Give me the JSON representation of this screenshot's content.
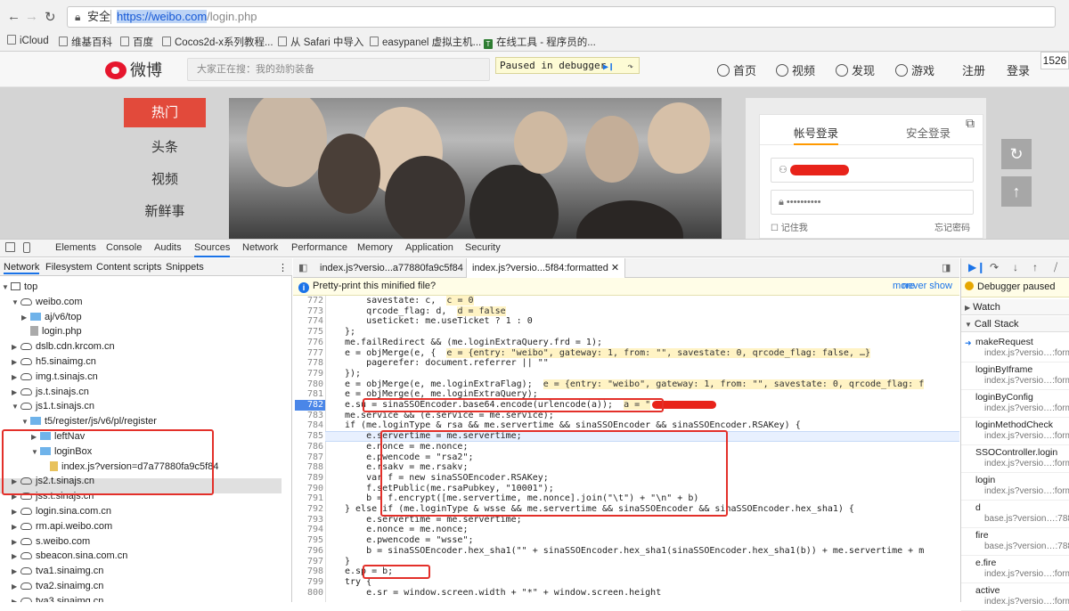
{
  "browser": {
    "security_label": "安全",
    "url_host": "https://weibo.com",
    "url_path": "/login.php",
    "bookmarks": [
      "iCloud",
      "维基百科",
      "百度",
      "Cocos2d-x系列教程...",
      "从 Safari 中导入",
      "easypanel 虚拟主机...",
      "在线工具 - 程序员的..."
    ]
  },
  "weibo": {
    "logo_text": "微博",
    "search_placeholder": "大家正在搜：我的劲豹装备",
    "paused_banner": "Paused in debugger",
    "nav": [
      "首页",
      "视频",
      "发现",
      "游戏",
      "注册",
      "登录"
    ],
    "corner_tip": "1526",
    "side_hot": "热门",
    "side_items": [
      "头条",
      "视频",
      "新鲜事"
    ],
    "login_tabs": [
      "帐号登录",
      "安全登录"
    ],
    "password_mask": "••••••••••",
    "remember": "记住我",
    "forgot": "忘记密码"
  },
  "devtools": {
    "tabs": [
      "Elements",
      "Console",
      "Audits",
      "Sources",
      "Network",
      "Performance",
      "Memory",
      "Application",
      "Security"
    ],
    "active_tab": "Sources",
    "nav_tabs": [
      "Network",
      "Filesystem",
      "Content scripts",
      "Snippets"
    ],
    "tree": [
      {
        "label": "top",
        "icon": "frame",
        "level": 0,
        "arrow": "▼"
      },
      {
        "label": "weibo.com",
        "icon": "cloud",
        "level": 1,
        "arrow": "▼"
      },
      {
        "label": "aj/v6/top",
        "icon": "folder",
        "level": 2,
        "arrow": "▶"
      },
      {
        "label": "login.php",
        "icon": "file",
        "level": 2,
        "arrow": ""
      },
      {
        "label": "dslb.cdn.krcom.cn",
        "icon": "cloud",
        "level": 1,
        "arrow": "▶"
      },
      {
        "label": "h5.sinaimg.cn",
        "icon": "cloud",
        "level": 1,
        "arrow": "▶"
      },
      {
        "label": "img.t.sinajs.cn",
        "icon": "cloud",
        "level": 1,
        "arrow": "▶"
      },
      {
        "label": "js.t.sinajs.cn",
        "icon": "cloud",
        "level": 1,
        "arrow": "▶"
      },
      {
        "label": "js1.t.sinajs.cn",
        "icon": "cloud",
        "level": 1,
        "arrow": "▼"
      },
      {
        "label": "t5/register/js/v6/pl/register",
        "icon": "folder",
        "level": 2,
        "arrow": "▼"
      },
      {
        "label": "leftNav",
        "icon": "folder",
        "level": 3,
        "arrow": "▶"
      },
      {
        "label": "loginBox",
        "icon": "folder",
        "level": 3,
        "arrow": "▼"
      },
      {
        "label": "index.js?version=d7a77880fa9c5f84",
        "icon": "file-js",
        "level": 4,
        "arrow": ""
      },
      {
        "label": "js2.t.sinajs.cn",
        "icon": "cloud",
        "level": 1,
        "arrow": "▶"
      },
      {
        "label": "jss.t.sinajs.cn",
        "icon": "cloud",
        "level": 1,
        "arrow": "▶"
      },
      {
        "label": "login.sina.com.cn",
        "icon": "cloud",
        "level": 1,
        "arrow": "▶"
      },
      {
        "label": "rm.api.weibo.com",
        "icon": "cloud",
        "level": 1,
        "arrow": "▶"
      },
      {
        "label": "s.weibo.com",
        "icon": "cloud",
        "level": 1,
        "arrow": "▶"
      },
      {
        "label": "sbeacon.sina.com.cn",
        "icon": "cloud",
        "level": 1,
        "arrow": "▶"
      },
      {
        "label": "tva1.sinaimg.cn",
        "icon": "cloud",
        "level": 1,
        "arrow": "▶"
      },
      {
        "label": "tva2.sinaimg.cn",
        "icon": "cloud",
        "level": 1,
        "arrow": "▶"
      },
      {
        "label": "tva3.sinaimg.cn",
        "icon": "cloud",
        "level": 1,
        "arrow": "▶"
      }
    ],
    "editor_tabs": [
      "index.js?versio...a77880fa9c5f84",
      "index.js?versio...5f84:formatted"
    ],
    "pretty_print_msg": "Pretty-print this minified file?",
    "pretty_more": "more",
    "pretty_never": "never show",
    "breakpoint_line": "782",
    "code": [
      {
        "n": "772",
        "t": "    savestate: c,",
        "inl": "c = 0"
      },
      {
        "n": "773",
        "t": "    qrcode_flag: d,",
        "inl": "d = false"
      },
      {
        "n": "774",
        "t": "    useticket: me.useTicket ? 1 : 0",
        "inl": ""
      },
      {
        "n": "775",
        "t": "};",
        "inl": ""
      },
      {
        "n": "776",
        "t": "me.failRedirect && (me.loginExtraQuery.frd = 1);",
        "inl": ""
      },
      {
        "n": "777",
        "t": "e = objMerge(e, {",
        "inl": "e = {entry: \"weibo\", gateway: 1, from: \"\", savestate: 0, qrcode_flag: false, …}"
      },
      {
        "n": "778",
        "t": "    pagerefer: document.referrer || \"\"",
        "inl": ""
      },
      {
        "n": "779",
        "t": "});",
        "inl": ""
      },
      {
        "n": "780",
        "t": "e = objMerge(e, me.loginExtraFlag);",
        "inl": "e = {entry: \"weibo\", gateway: 1, from: \"\", savestate: 0, qrcode_flag: f"
      },
      {
        "n": "781",
        "t": "e = objMerge(e, me.loginExtraQuery);",
        "inl": ""
      },
      {
        "n": "782",
        "t": "e.su = sinaSSOEncoder.base64.encode(urlencode(a));",
        "inl": "a = \""
      },
      {
        "n": "783",
        "t": "me.service && (e.service = me.service);",
        "inl": ""
      },
      {
        "n": "784",
        "t": "if (me.loginType & rsa && me.servertime && sinaSSOEncoder && sinaSSOEncoder.RSAKey) {",
        "inl": ""
      },
      {
        "n": "785",
        "t": "    e.servertime = me.servertime;",
        "inl": ""
      },
      {
        "n": "786",
        "t": "    e.nonce = me.nonce;",
        "inl": ""
      },
      {
        "n": "787",
        "t": "    e.pwencode = \"rsa2\";",
        "inl": ""
      },
      {
        "n": "788",
        "t": "    e.rsakv = me.rsakv;",
        "inl": ""
      },
      {
        "n": "789",
        "t": "    var f = new sinaSSOEncoder.RSAKey;",
        "inl": ""
      },
      {
        "n": "790",
        "t": "    f.setPublic(me.rsaPubkey, \"10001\");",
        "inl": ""
      },
      {
        "n": "791",
        "t": "    b = f.encrypt([me.servertime, me.nonce].join(\"\\t\") + \"\\n\" + b)",
        "inl": ""
      },
      {
        "n": "792",
        "t": "} else if (me.loginType & wsse && me.servertime && sinaSSOEncoder && sinaSSOEncoder.hex_sha1) {",
        "inl": ""
      },
      {
        "n": "793",
        "t": "    e.servertime = me.servertime;",
        "inl": ""
      },
      {
        "n": "794",
        "t": "    e.nonce = me.nonce;",
        "inl": ""
      },
      {
        "n": "795",
        "t": "    e.pwencode = \"wsse\";",
        "inl": ""
      },
      {
        "n": "796",
        "t": "    b = sinaSSOEncoder.hex_sha1(\"\" + sinaSSOEncoder.hex_sha1(sinaSSOEncoder.hex_sha1(b)) + me.servertime + m",
        "inl": ""
      },
      {
        "n": "797",
        "t": "}",
        "inl": ""
      },
      {
        "n": "798",
        "t": "e.sp = b;",
        "inl": ""
      },
      {
        "n": "799",
        "t": "try {",
        "inl": ""
      },
      {
        "n": "800",
        "t": "    e.sr = window.screen.width + \"*\" + window.screen.height",
        "inl": ""
      }
    ],
    "debugger_paused": "Debugger paused",
    "watch": "Watch",
    "call_stack": "Call Stack",
    "frames": [
      {
        "fn": "makeRequest",
        "loc": "index.js?versio…:form"
      },
      {
        "fn": "loginByIframe",
        "loc": "index.js?versio…:form"
      },
      {
        "fn": "loginByConfig",
        "loc": "index.js?versio…:form"
      },
      {
        "fn": "loginMethodCheck",
        "loc": "index.js?versio…:form"
      },
      {
        "fn": "SSOController.login",
        "loc": "index.js?versio…:form"
      },
      {
        "fn": "login",
        "loc": "index.js?versio…:form"
      },
      {
        "fn": "d",
        "loc": "base.js?version…:788"
      },
      {
        "fn": "fire",
        "loc": "base.js?version…:788"
      },
      {
        "fn": "e.fire",
        "loc": "index.js?versio…:form"
      },
      {
        "fn": "active",
        "loc": "index.js?versio…:form"
      }
    ]
  }
}
